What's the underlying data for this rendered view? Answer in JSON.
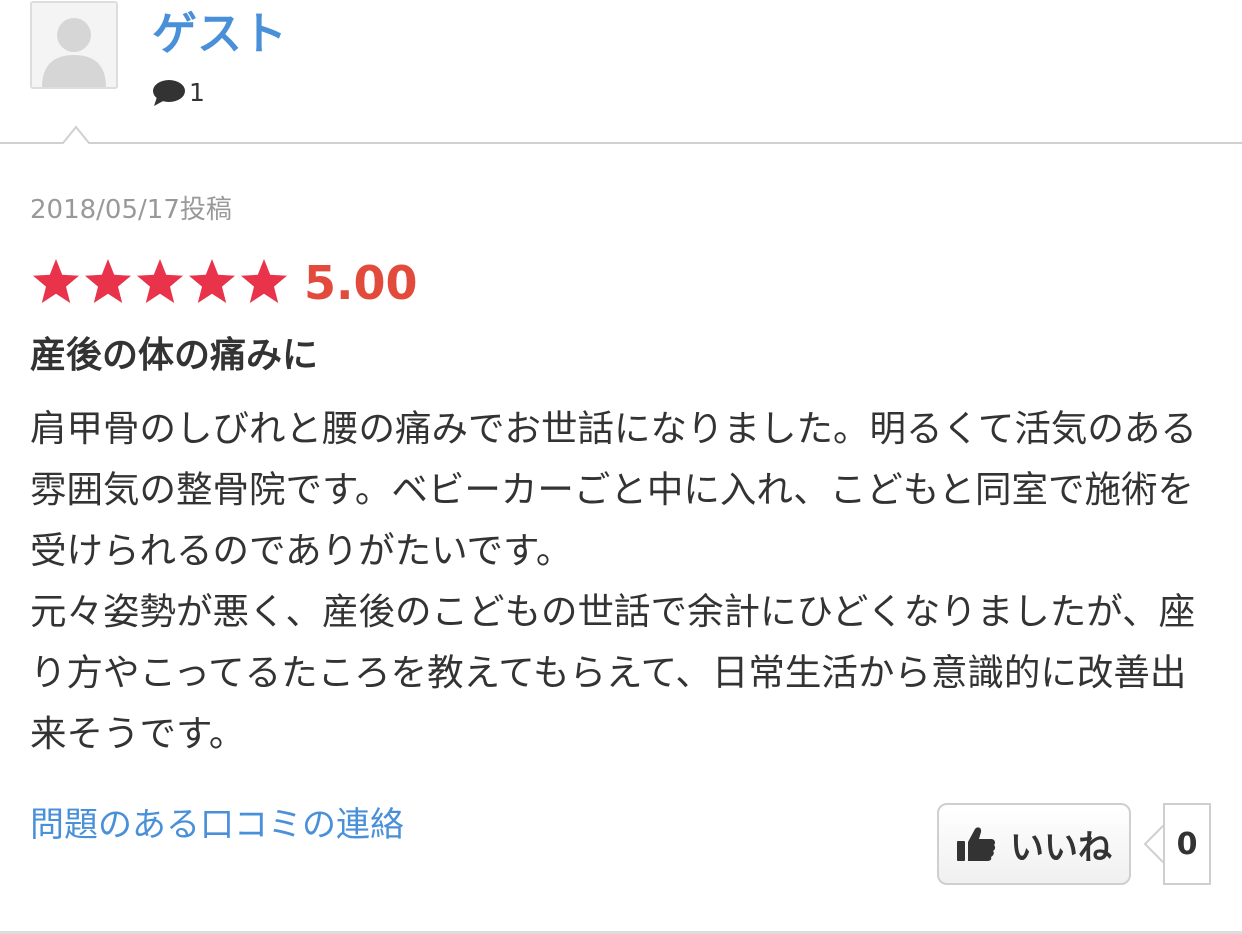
{
  "user": {
    "name": "ゲスト",
    "comment_count": "1"
  },
  "review": {
    "date": "2018/05/17投稿",
    "rating": 5,
    "rating_max": 5,
    "rating_label": "5.00",
    "title": "産後の体の痛みに",
    "body_paragraphs": [
      "肩甲骨のしびれと腰の痛みでお世話になりました。明るくて活気のある雰囲気の整骨院です。ベビーカーごと中に入れ、こどもと同室で施術を受けられるのでありがたいです。",
      "元々姿勢が悪く、産後のこどもの世話で余計にひどくなりましたが、座り方やこってるたころを教えてもらえて、日常生活から意識的に改善出来そうです。"
    ]
  },
  "actions": {
    "report_label": "問題のある口コミの連絡",
    "like_label": "いいね",
    "like_count": "0"
  },
  "colors": {
    "star": "#e8334a",
    "rating_text": "#e24a3b",
    "link": "#4a90d9"
  },
  "icons": {
    "avatar": "default-user-silhouette",
    "comment": "speech-bubble-icon",
    "like": "thumbs-up-icon"
  }
}
